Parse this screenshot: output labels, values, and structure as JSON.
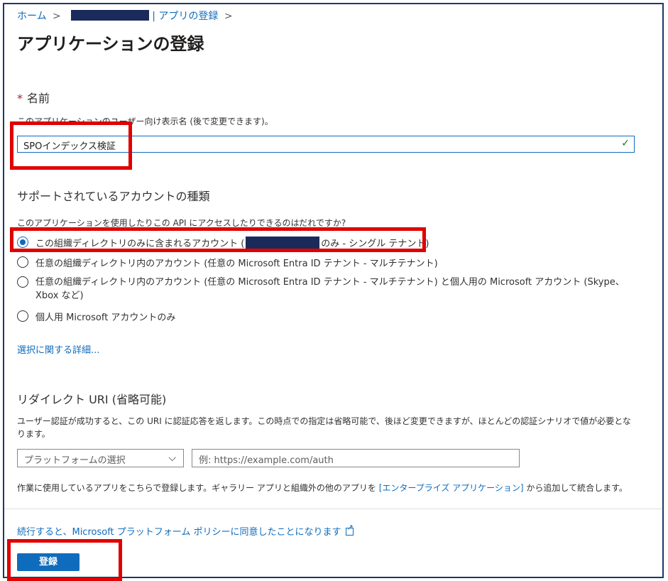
{
  "breadcrumb": {
    "home": "ホーム",
    "sep1": ">",
    "current": "| アプリの登録",
    "sep2": ">"
  },
  "page": {
    "title": "アプリケーションの登録",
    "more": "···"
  },
  "name_section": {
    "required_mark": "*",
    "label": "名前",
    "help": "このアプリケーションのユーザー向け表示名 (後で変更できます)。",
    "value": "SPOインデックス検証",
    "valid_icon": "✓"
  },
  "account_section": {
    "heading": "サポートされているアカウントの種類",
    "question": "このアプリケーションを使用したりこの API にアクセスしたりできるのはだれですか?",
    "options": [
      {
        "label_prefix": "この組織ディレクトリのみに含まれるアカウント (",
        "label_suffix": "のみ - シングル テナント)",
        "checked": true
      },
      {
        "label": "任意の組織ディレクトリ内のアカウント (任意の Microsoft Entra ID テナント - マルチテナント)",
        "checked": false
      },
      {
        "label": "任意の組織ディレクトリ内のアカウント (任意の Microsoft Entra ID テナント - マルチテナント) と個人用の Microsoft アカウント (Skype、Xbox など)",
        "checked": false
      },
      {
        "label": "個人用 Microsoft アカウントのみ",
        "checked": false
      }
    ],
    "details_link": "選択に関する詳細..."
  },
  "redirect_section": {
    "heading": "リダイレクト URI (省略可能)",
    "help": "ユーザー認証が成功すると、この URI に認証応答を返します。この時点での指定は省略可能で、後ほど変更できますが、ほとんどの認証シナリオで値が必要となります。",
    "platform_select": "プラットフォームの選択",
    "uri_placeholder": "例: https://example.com/auth",
    "note_prefix": "作業に使用しているアプリをこちらで登録します。ギャラリー アプリと組織外の他のアプリを",
    "note_link": "[エンタープライズ アプリケーション]",
    "note_suffix": "から追加して統合します。"
  },
  "footer": {
    "policy_link": "続行すると、Microsoft プラットフォーム ポリシーに同意したことになります",
    "register_button": "登録"
  },
  "colors": {
    "accent": "#0f6cbd",
    "highlight_box": "#e00000",
    "redaction": "#1a2a5a"
  }
}
